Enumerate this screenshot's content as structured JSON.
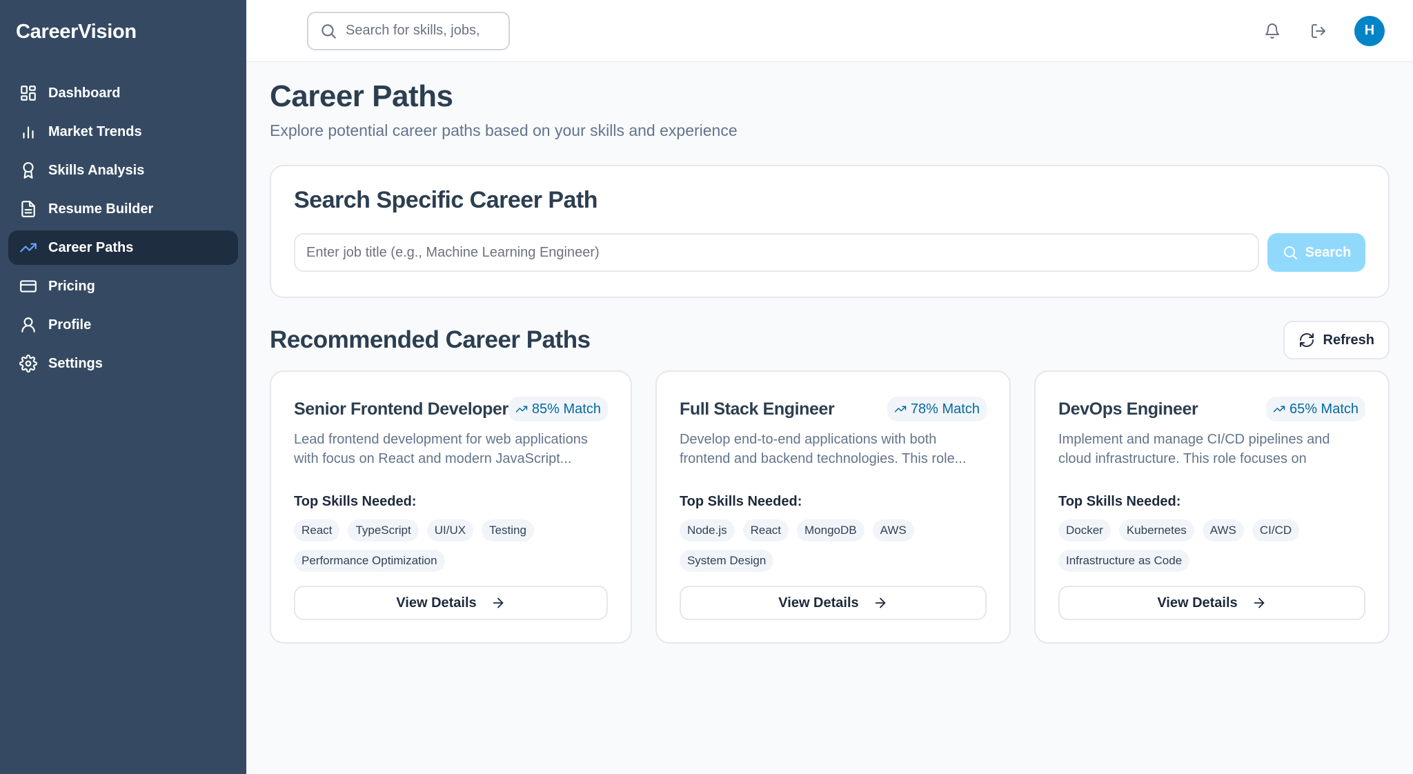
{
  "app": {
    "brand": "CareerVision"
  },
  "sidebar": {
    "items": [
      {
        "label": "Dashboard",
        "icon": "dashboard-icon",
        "active": false
      },
      {
        "label": "Market Trends",
        "icon": "bar-chart-icon",
        "active": false
      },
      {
        "label": "Skills Analysis",
        "icon": "award-icon",
        "active": false
      },
      {
        "label": "Resume Builder",
        "icon": "document-icon",
        "active": false
      },
      {
        "label": "Career Paths",
        "icon": "trending-up-icon",
        "active": true
      },
      {
        "label": "Pricing",
        "icon": "credit-card-icon",
        "active": false
      },
      {
        "label": "Profile",
        "icon": "user-icon",
        "active": false
      },
      {
        "label": "Settings",
        "icon": "gear-icon",
        "active": false
      }
    ]
  },
  "topbar": {
    "search_placeholder": "Search for skills, jobs,",
    "avatar_initial": "H",
    "accent_color": "#0284c7"
  },
  "page": {
    "title": "Career Paths",
    "subtitle": "Explore potential career paths based on your skills and experience"
  },
  "search_card": {
    "title": "Search Specific Career Path",
    "input_placeholder": "Enter job title (e.g., Machine Learning Engineer)",
    "button_label": "Search"
  },
  "recommended": {
    "title": "Recommended Career Paths",
    "refresh_label": "Refresh",
    "skills_label": "Top Skills Needed:",
    "view_label": "View Details",
    "cards": [
      {
        "title": "Senior Frontend Developer",
        "match": "85% Match",
        "description": "Lead frontend development for web applications with focus on React and modern JavaScript...",
        "skills": [
          "React",
          "TypeScript",
          "UI/UX",
          "Testing",
          "Performance Optimization"
        ]
      },
      {
        "title": "Full Stack Engineer",
        "match": "78% Match",
        "description": "Develop end-to-end applications with both frontend and backend technologies. This role...",
        "skills": [
          "Node.js",
          "React",
          "MongoDB",
          "AWS",
          "System Design"
        ]
      },
      {
        "title": "DevOps Engineer",
        "match": "65% Match",
        "description": "Implement and manage CI/CD pipelines and cloud infrastructure. This role focuses on automation,...",
        "skills": [
          "Docker",
          "Kubernetes",
          "AWS",
          "CI/CD",
          "Infrastructure as Code"
        ]
      }
    ]
  }
}
